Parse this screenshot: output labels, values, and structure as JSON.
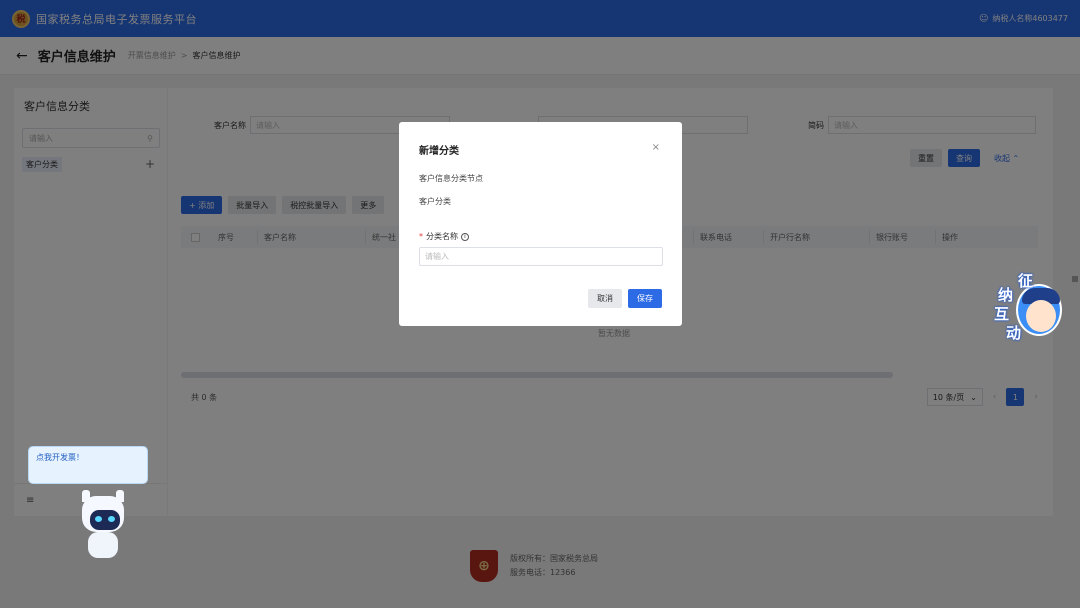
{
  "header": {
    "app_title": "国家税务总局电子发票服务平台",
    "emblem_text": "税",
    "user_name": "纳税人名称4603477"
  },
  "subheader": {
    "page_title": "客户信息维护",
    "breadcrumb": [
      "开票信息维护",
      "客户信息维护"
    ]
  },
  "sidebar": {
    "title": "客户信息分类",
    "search_placeholder": "请输入",
    "items": [
      {
        "label": "客户分类"
      }
    ]
  },
  "filters": {
    "customer_name_label": "客户名称",
    "customer_name_placeholder": "请输入",
    "abbr_label": "简码",
    "abbr_placeholder": "请输入",
    "reset_label": "重置",
    "query_label": "查询",
    "collapse_label": "收起"
  },
  "toolbar": {
    "add_label": "添加",
    "batch_import_label": "批量导入",
    "batch_import2_label": "税控批量导入",
    "more_label": "更多"
  },
  "table": {
    "columns": [
      "序号",
      "客户名称",
      "统一社",
      "联系电话",
      "开户行名称",
      "银行账号",
      "操作"
    ],
    "empty_text": "暂无数据"
  },
  "pagination": {
    "total_text": "共 0 条",
    "page_size": "10 条/页",
    "current_page": "1"
  },
  "footer": {
    "copyright": "版权所有：国家税务总局",
    "hotline": "服务电话：12366"
  },
  "assistant": {
    "bubble_text": "点我开发票！"
  },
  "helper": {
    "chars": [
      "征",
      "纳",
      "互",
      "动"
    ]
  },
  "dialog": {
    "title": "新增分类",
    "section_label": "客户信息分类节点",
    "node_value": "客户分类",
    "field_label": "分类名称",
    "field_placeholder": "请输入",
    "cancel_label": "取消",
    "save_label": "保存"
  },
  "colors": {
    "primary": "#2d6ae6",
    "header_bg": "#2d6ae6"
  }
}
